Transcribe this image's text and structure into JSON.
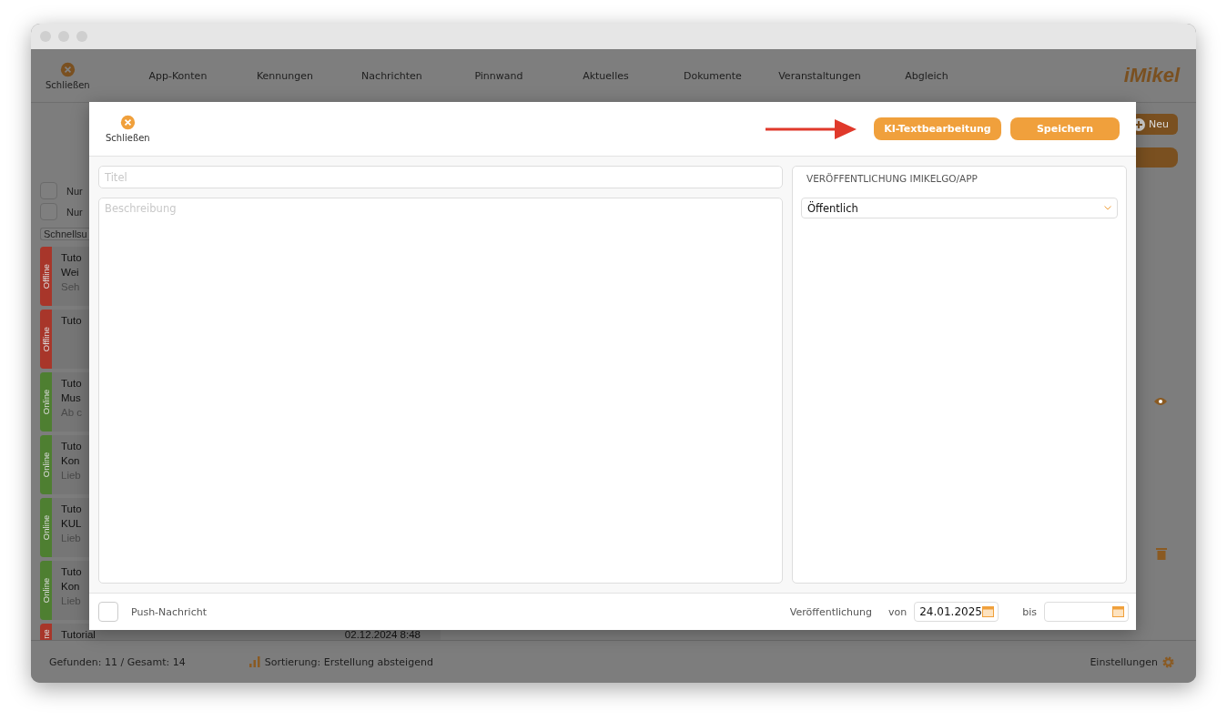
{
  "toolbar": {
    "close_label": "Schließen",
    "nav": [
      "App-Konten",
      "Kennungen",
      "Nachrichten",
      "Pinnwand",
      "Aktuelles",
      "Dokumente",
      "Veranstaltungen",
      "Abgleich"
    ],
    "logo": "iMikel"
  },
  "background": {
    "new_button": "Neu",
    "filters": [
      {
        "label": "Nur",
        "checked": false
      },
      {
        "label": "Nur",
        "checked": false
      }
    ],
    "search": "Schnellsu",
    "items": [
      {
        "status": "Offline",
        "color": "#a8362a",
        "lines": [
          "Tuto",
          "Wei",
          "Seh"
        ]
      },
      {
        "status": "Offline",
        "color": "#a8362a",
        "lines": [
          "Tuto"
        ]
      },
      {
        "status": "Online",
        "color": "#4e7f31",
        "lines": [
          "Tuto",
          "Mus",
          "Ab c"
        ]
      },
      {
        "status": "Online",
        "color": "#4e7f31",
        "lines": [
          "Tuto",
          "Kon",
          "Lieb"
        ]
      },
      {
        "status": "Online",
        "color": "#4e7f31",
        "lines": [
          "Tuto",
          "KUL",
          "Lieb"
        ]
      },
      {
        "status": "Online",
        "color": "#4e7f31",
        "lines": [
          "Tuto",
          "Kon",
          "Lieb"
        ]
      },
      {
        "status": "ne",
        "color": "#a8362a",
        "lines": [
          "Tutorial"
        ],
        "date": "02.12.2024 8:48"
      }
    ]
  },
  "status_bar": {
    "found": "Gefunden: 11 / Gesamt: 14",
    "sort": "Sortierung: Erstellung absteigend",
    "settings": "Einstellungen"
  },
  "dialog": {
    "close_label": "Schließen",
    "buttons": [
      "KI-Textbearbeitung",
      "Speichern"
    ],
    "title_placeholder": "Titel",
    "description_placeholder": "Beschreibung",
    "publish_panel": {
      "heading": "VERÖFFENTLICHUNG IMIKELGO/APP",
      "visibility": "Öffentlich"
    },
    "push": {
      "label": "Push-Nachricht",
      "checked": false
    },
    "publication": {
      "label": "Veröffentlichung",
      "from_label": "von",
      "from": "24.01.2025",
      "to_label": "bis"
    }
  }
}
